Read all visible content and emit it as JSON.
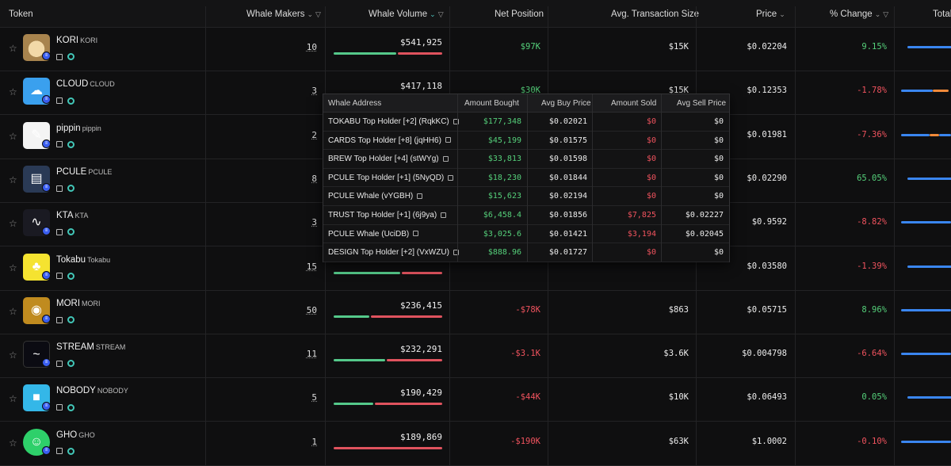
{
  "columns": {
    "token": "Token",
    "whale_makers": "Whale Makers",
    "whale_volume": "Whale Volume",
    "net_position": "Net Position",
    "avg_tx_size": "Avg. Transaction Size",
    "price": "Price",
    "pct_change": "% Change",
    "total": "Total"
  },
  "colors": {
    "positive": "#55d07a",
    "negative": "#f0535e",
    "bar_buy": "#55c98a",
    "bar_sell": "#e0535e",
    "accent_blue": "#3a86f0",
    "accent_orange": "#f08a3a"
  },
  "tokens": [
    {
      "name": "KORI",
      "symbol": "KORI",
      "makers": "10",
      "volume": "$541,925",
      "buy_ratio": 0.59,
      "net": "$97K",
      "net_sign": "pos",
      "avg": "$15K",
      "price": "$0.02204",
      "change": "9.15%",
      "change_sign": "pos",
      "logo": "kori-logo",
      "chain": "solana"
    },
    {
      "name": "CLOUD",
      "symbol": "CLOUD",
      "makers": "3",
      "volume": "$417,118",
      "buy_ratio": 0.55,
      "net": "$30K",
      "net_sign": "pos",
      "avg": "$15K",
      "price": "$0.12353",
      "change": "-1.78%",
      "change_sign": "neg",
      "logo": "cloud-logo",
      "chain": "solana"
    },
    {
      "name": "pippin",
      "symbol": "pippin",
      "makers": "2",
      "volume": "",
      "buy_ratio": 0.5,
      "net": "",
      "net_sign": "pos",
      "avg": "",
      "price": "$0.01981",
      "change": "-7.36%",
      "change_sign": "neg",
      "logo": "pippin-logo",
      "chain": "solana"
    },
    {
      "name": "PCULE",
      "symbol": "PCULE",
      "makers": "8",
      "volume": "",
      "buy_ratio": 0.5,
      "net": "",
      "net_sign": "pos",
      "avg": "",
      "price": "$0.02290",
      "change": "65.05%",
      "change_sign": "pos",
      "logo": "pcule-logo",
      "chain": "solana"
    },
    {
      "name": "KTA",
      "symbol": "KTA",
      "makers": "3",
      "volume": "",
      "buy_ratio": 0.5,
      "net": "",
      "net_sign": "pos",
      "avg": "",
      "price": "$0.9592",
      "change": "-8.82%",
      "change_sign": "neg",
      "logo": "kta-logo",
      "chain": "base"
    },
    {
      "name": "Tokabu",
      "symbol": "Tokabu",
      "makers": "15",
      "volume": "",
      "buy_ratio": 0.63,
      "net": "",
      "net_sign": "pos",
      "avg": "",
      "price": "$0.03580",
      "change": "-1.39%",
      "change_sign": "neg",
      "logo": "tokabu-logo",
      "chain": "solana"
    },
    {
      "name": "MORI",
      "symbol": "MORI",
      "makers": "50",
      "volume": "$236,415",
      "buy_ratio": 0.34,
      "net": "-$78K",
      "net_sign": "neg",
      "avg": "$863",
      "price": "$0.05715",
      "change": "8.96%",
      "change_sign": "pos",
      "logo": "mori-logo",
      "chain": "solana"
    },
    {
      "name": "STREAM",
      "symbol": "STREAM",
      "makers": "11",
      "volume": "$232,291",
      "buy_ratio": 0.49,
      "net": "-$3.1K",
      "net_sign": "neg",
      "avg": "$3.6K",
      "price": "$0.004798",
      "change": "-6.64%",
      "change_sign": "neg",
      "logo": "stream-logo",
      "chain": "solana"
    },
    {
      "name": "NOBODY",
      "symbol": "NOBODY",
      "makers": "5",
      "volume": "$190,429",
      "buy_ratio": 0.38,
      "net": "-$44K",
      "net_sign": "neg",
      "avg": "$10K",
      "price": "$0.06493",
      "change": "0.05%",
      "change_sign": "pos",
      "logo": "nobody-logo",
      "chain": "solana"
    },
    {
      "name": "GHO",
      "symbol": "GHO",
      "makers": "1",
      "volume": "$189,869",
      "buy_ratio": 0.0,
      "net": "-$190K",
      "net_sign": "neg",
      "avg": "$63K",
      "price": "$1.0002",
      "change": "-0.10%",
      "change_sign": "neg",
      "logo": "gho-logo",
      "chain": "ethereum"
    }
  ],
  "popup": {
    "headers": [
      "Whale Address",
      "Amount Bought",
      "Avg Buy Price",
      "Amount Sold",
      "Avg Sell Price"
    ],
    "rows": [
      {
        "address": "TOKABU Top Holder [+2] (RqkKC)",
        "bought": "$177,348",
        "buy_price": "$0.02021",
        "sold": "$0",
        "sell_price": "$0"
      },
      {
        "address": "CARDS Top Holder [+8] (jqHH6)",
        "bought": "$45,199",
        "buy_price": "$0.01575",
        "sold": "$0",
        "sell_price": "$0"
      },
      {
        "address": "BREW Top Holder [+4] (stWYg)",
        "bought": "$33,813",
        "buy_price": "$0.01598",
        "sold": "$0",
        "sell_price": "$0"
      },
      {
        "address": "PCULE Top Holder [+1] (5NyQD)",
        "bought": "$18,230",
        "buy_price": "$0.01844",
        "sold": "$0",
        "sell_price": "$0"
      },
      {
        "address": "PCULE Whale (vYGBH)",
        "bought": "$15,623",
        "buy_price": "$0.02194",
        "sold": "$0",
        "sell_price": "$0"
      },
      {
        "address": "TRUST Top Holder [+1] (6j9ya)",
        "bought": "$6,458.4",
        "buy_price": "$0.01856",
        "sold": "$7,825",
        "sell_price": "$0.02227"
      },
      {
        "address": "PCULE Whale (UciDB)",
        "bought": "$3,025.6",
        "buy_price": "$0.01421",
        "sold": "$3,194",
        "sell_price": "$0.02045"
      },
      {
        "address": "DESIGN Top Holder [+2] (VxWZU)",
        "bought": "$888.96",
        "buy_price": "$0.01727",
        "sold": "$0",
        "sell_price": "$0"
      }
    ]
  }
}
